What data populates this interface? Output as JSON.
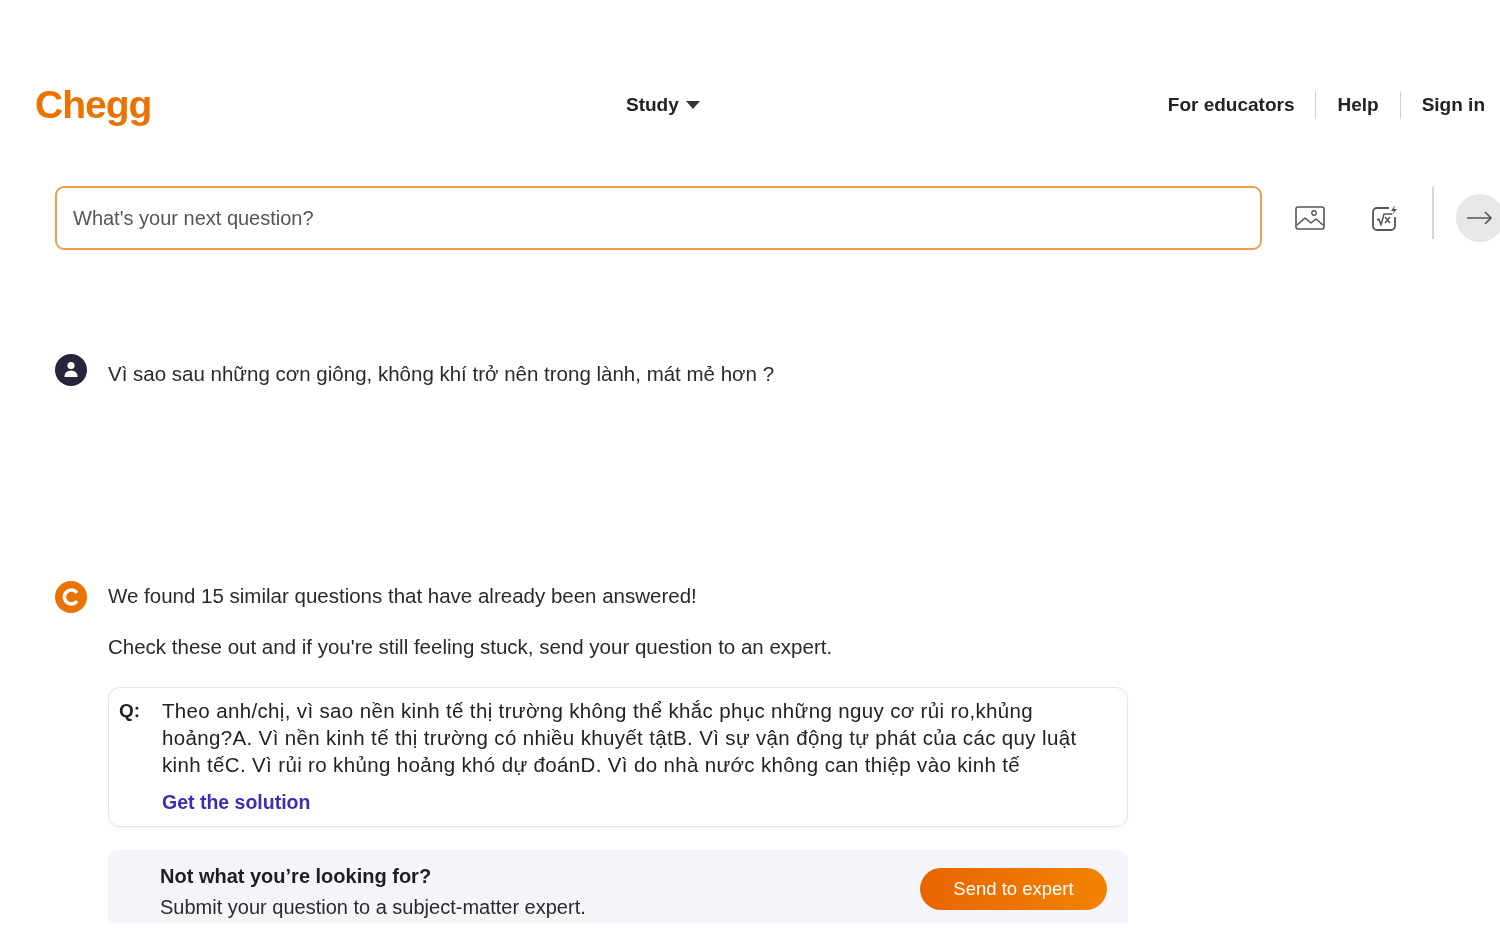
{
  "header": {
    "logo": "Chegg",
    "study_menu": "Study",
    "links": [
      "For educators",
      "Help",
      "Sign in"
    ]
  },
  "search": {
    "placeholder": "What's your next question?"
  },
  "messages": [
    {
      "kind": "user",
      "paragraphs": [
        "Vì sao sau những cơn giông, không khí trở nên trong lành, mát mẻ hơn ?"
      ]
    },
    {
      "kind": "assistant",
      "paragraphs": [
        "We found 15 similar questions that have already been answered!",
        "Check these out and if you're still feeling stuck, send your question to an expert."
      ]
    }
  ],
  "similar_questions": [
    {
      "label": "Q:",
      "text": "Theo anh/chị, vì sao nền kinh tế thị trường không thể khắc phục những nguy cơ rủi ro,khủng hoảng?A. Vì nền kinh tế thị trường có nhiều khuyết tậtB. Vì sự vận động tự phát của các quy luật kinh tếC. Vì rủi ro khủng hoảng khó dự đoánD. Vì do nhà nước không can thiệp vào kinh tế",
      "link": "Get the solution"
    }
  ],
  "expert_prompt": {
    "title": "Not what you’re looking for?",
    "subtitle": "Submit your question to a subject-matter expert.",
    "button": "Send to expert"
  }
}
